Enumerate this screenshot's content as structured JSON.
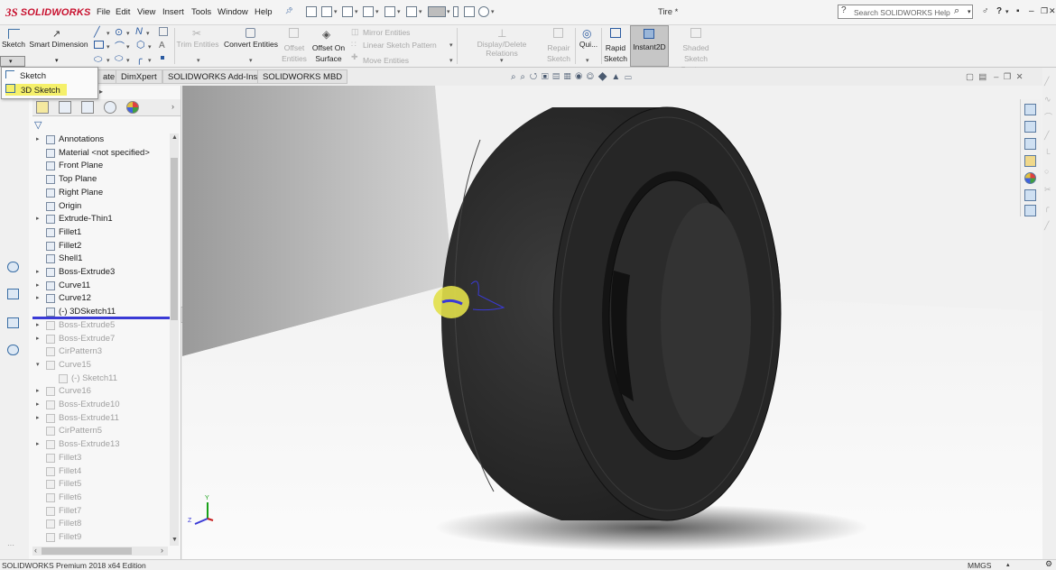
{
  "app": {
    "logo_text": "SOLIDWORKS",
    "document_title": "Tire *"
  },
  "menu": [
    "File",
    "Edit",
    "View",
    "Insert",
    "Tools",
    "Window",
    "Help"
  ],
  "search": {
    "placeholder": "Search SOLIDWORKS Help"
  },
  "window_controls": {
    "user": "♂",
    "help": "?",
    "minimize": "–",
    "restore": "❐",
    "close": "✕"
  },
  "toolbar": {
    "sketch_label": "Sketch",
    "smart_dimension_label": "Smart Dimension",
    "trim_entities_label": "Trim Entities",
    "convert_entities_label": "Convert Entities",
    "offset_entities_label": "Offset Entities",
    "offset_on_surface_label": "Offset On Surface",
    "mirror_entities_label": "Mirror Entities",
    "linear_sketch_pattern_label": "Linear Sketch Pattern",
    "move_entities_label": "Move Entities",
    "display_delete_relations_label": "Display/Delete Relations",
    "repair_sketch_label": "Repair Sketch",
    "quick_snaps_label": "Qui...",
    "rapid_sketch_label": "Rapid Sketch",
    "instant2d_label": "Instant2D",
    "shaded_sketch_contours_label": "Shaded Sketch Contours"
  },
  "sketch_dropdown": {
    "items": [
      "Sketch",
      "3D Sketch"
    ],
    "highlighted": "3D Sketch"
  },
  "tabs": [
    "ate",
    "DimXpert",
    "SOLIDWORKS Add-Ins",
    "SOLIDWORKS MBD"
  ],
  "feature_tree": {
    "items": [
      {
        "label": "Annotations",
        "state": "normal",
        "expand": true
      },
      {
        "label": "Material <not specified>",
        "state": "normal",
        "expand": false
      },
      {
        "label": "Front Plane",
        "state": "normal",
        "expand": false
      },
      {
        "label": "Top Plane",
        "state": "normal",
        "expand": false
      },
      {
        "label": "Right Plane",
        "state": "normal",
        "expand": false
      },
      {
        "label": "Origin",
        "state": "normal",
        "expand": false
      },
      {
        "label": "Extrude-Thin1",
        "state": "normal",
        "expand": true
      },
      {
        "label": "Fillet1",
        "state": "normal",
        "expand": false
      },
      {
        "label": "Fillet2",
        "state": "normal",
        "expand": false
      },
      {
        "label": "Shell1",
        "state": "normal",
        "expand": false
      },
      {
        "label": "Boss-Extrude3",
        "state": "normal",
        "expand": true
      },
      {
        "label": "Curve11",
        "state": "normal",
        "expand": true
      },
      {
        "label": "Curve12",
        "state": "normal",
        "expand": true
      },
      {
        "label": "(-) 3DSketch11",
        "state": "normal",
        "expand": false
      },
      {
        "label": "Boss-Extrude5",
        "state": "dim",
        "expand": true
      },
      {
        "label": "Boss-Extrude7",
        "state": "dim",
        "expand": true
      },
      {
        "label": "CirPattern3",
        "state": "dim",
        "expand": false
      },
      {
        "label": "Curve15",
        "state": "dim",
        "expand": true
      },
      {
        "label": "(-) Sketch11",
        "state": "dim",
        "expand": false,
        "indent": true
      },
      {
        "label": "Curve16",
        "state": "dim",
        "expand": true
      },
      {
        "label": "Boss-Extrude10",
        "state": "dim",
        "expand": true
      },
      {
        "label": "Boss-Extrude11",
        "state": "dim",
        "expand": true
      },
      {
        "label": "CirPattern5",
        "state": "dim",
        "expand": false
      },
      {
        "label": "Boss-Extrude13",
        "state": "dim",
        "expand": true
      },
      {
        "label": "Fillet3",
        "state": "dim",
        "expand": false
      },
      {
        "label": "Fillet4",
        "state": "dim",
        "expand": false
      },
      {
        "label": "Fillet5",
        "state": "dim",
        "expand": false
      },
      {
        "label": "Fillet6",
        "state": "dim",
        "expand": false
      },
      {
        "label": "Fillet7",
        "state": "dim",
        "expand": false
      },
      {
        "label": "Fillet8",
        "state": "dim",
        "expand": false
      },
      {
        "label": "Fillet9",
        "state": "dim",
        "expand": false
      }
    ]
  },
  "triad": {
    "y_label": "Y",
    "z_label": "Z"
  },
  "status": {
    "text": "SOLIDWORKS Premium 2018 x64 Edition",
    "units": "MMGS"
  },
  "colors": {
    "accent": "#c8102e",
    "highlight": "#f5f06a",
    "rollback": "#3a3ad6",
    "tire": "#2a2a2a"
  }
}
